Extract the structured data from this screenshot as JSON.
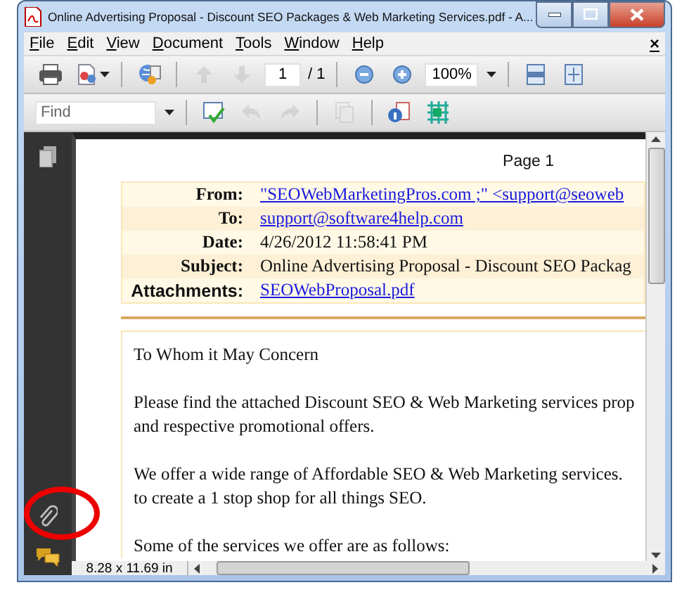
{
  "window": {
    "title": "Online Advertising Proposal - Discount SEO Packages & Web Marketing Services.pdf - A..."
  },
  "menu_bar": {
    "items": [
      {
        "label": "File"
      },
      {
        "label": "Edit"
      },
      {
        "label": "View"
      },
      {
        "label": "Document"
      },
      {
        "label": "Tools"
      },
      {
        "label": "Window"
      },
      {
        "label": "Help"
      }
    ],
    "close_glyph": "×"
  },
  "toolbar_1": {
    "items": [
      {
        "kind": "print",
        "disabled": false
      },
      {
        "kind": "share",
        "disabled": false
      },
      {
        "kind": "separator"
      },
      {
        "kind": "collaborate",
        "disabled": false
      },
      {
        "kind": "separator"
      },
      {
        "kind": "previous-page",
        "disabled": true
      },
      {
        "kind": "next-page",
        "disabled": true
      },
      {
        "kind": "page-field",
        "value": "1",
        "total": "/ 1"
      },
      {
        "kind": "separator"
      },
      {
        "kind": "zoom-out",
        "disabled": false
      },
      {
        "kind": "zoom-in",
        "disabled": false
      },
      {
        "kind": "zoom-field",
        "value": "100%"
      },
      {
        "kind": "separator"
      },
      {
        "kind": "fit-width",
        "disabled": false
      },
      {
        "kind": "fit-page",
        "disabled": false
      }
    ]
  },
  "toolbar_2": {
    "items": [
      {
        "kind": "find-field",
        "placeholder": "Find"
      },
      {
        "kind": "separator"
      },
      {
        "kind": "spell-check",
        "disabled": false
      },
      {
        "kind": "undo",
        "disabled": true
      },
      {
        "kind": "redo",
        "disabled": true
      },
      {
        "kind": "separator"
      },
      {
        "kind": "copy",
        "disabled": true
      },
      {
        "kind": "separator"
      },
      {
        "kind": "info",
        "disabled": false
      },
      {
        "kind": "grid",
        "disabled": false
      }
    ]
  },
  "sidebar": {
    "items": [
      {
        "kind": "pages",
        "circled": false
      },
      {
        "kind": "attachments",
        "circled": true
      },
      {
        "kind": "comments",
        "circled": false
      }
    ]
  },
  "page": {
    "label": "Page 1",
    "header_rows": [
      {
        "label": "From:",
        "value": "\"SEOWebMarketingPros.com ;\" <support@seoweb",
        "kind": "link"
      },
      {
        "label": "To:",
        "value": "support@software4help.com",
        "kind": "link"
      },
      {
        "label": "Date:",
        "value": "4/26/2012 11:58:41 PM",
        "kind": "text"
      },
      {
        "label": "Subject:",
        "value": "Online Advertising Proposal - Discount SEO Packag",
        "kind": "text"
      },
      {
        "label": "Attachments:",
        "value": "SEOWebProposal.pdf",
        "kind": "attachment"
      }
    ],
    "paragraphs": [
      [
        "To Whom it May Concern"
      ],
      [
        "Please find the attached Discount SEO & Web Marketing services prop",
        "and respective promotional offers."
      ],
      [
        "We offer a wide range of Affordable SEO & Web Marketing services.",
        "to create a 1 stop shop for all things SEO."
      ],
      [
        "Some of the services we offer are as follows:"
      ]
    ]
  },
  "status_bar": {
    "page_size": "8.28 x 11.69 in"
  }
}
